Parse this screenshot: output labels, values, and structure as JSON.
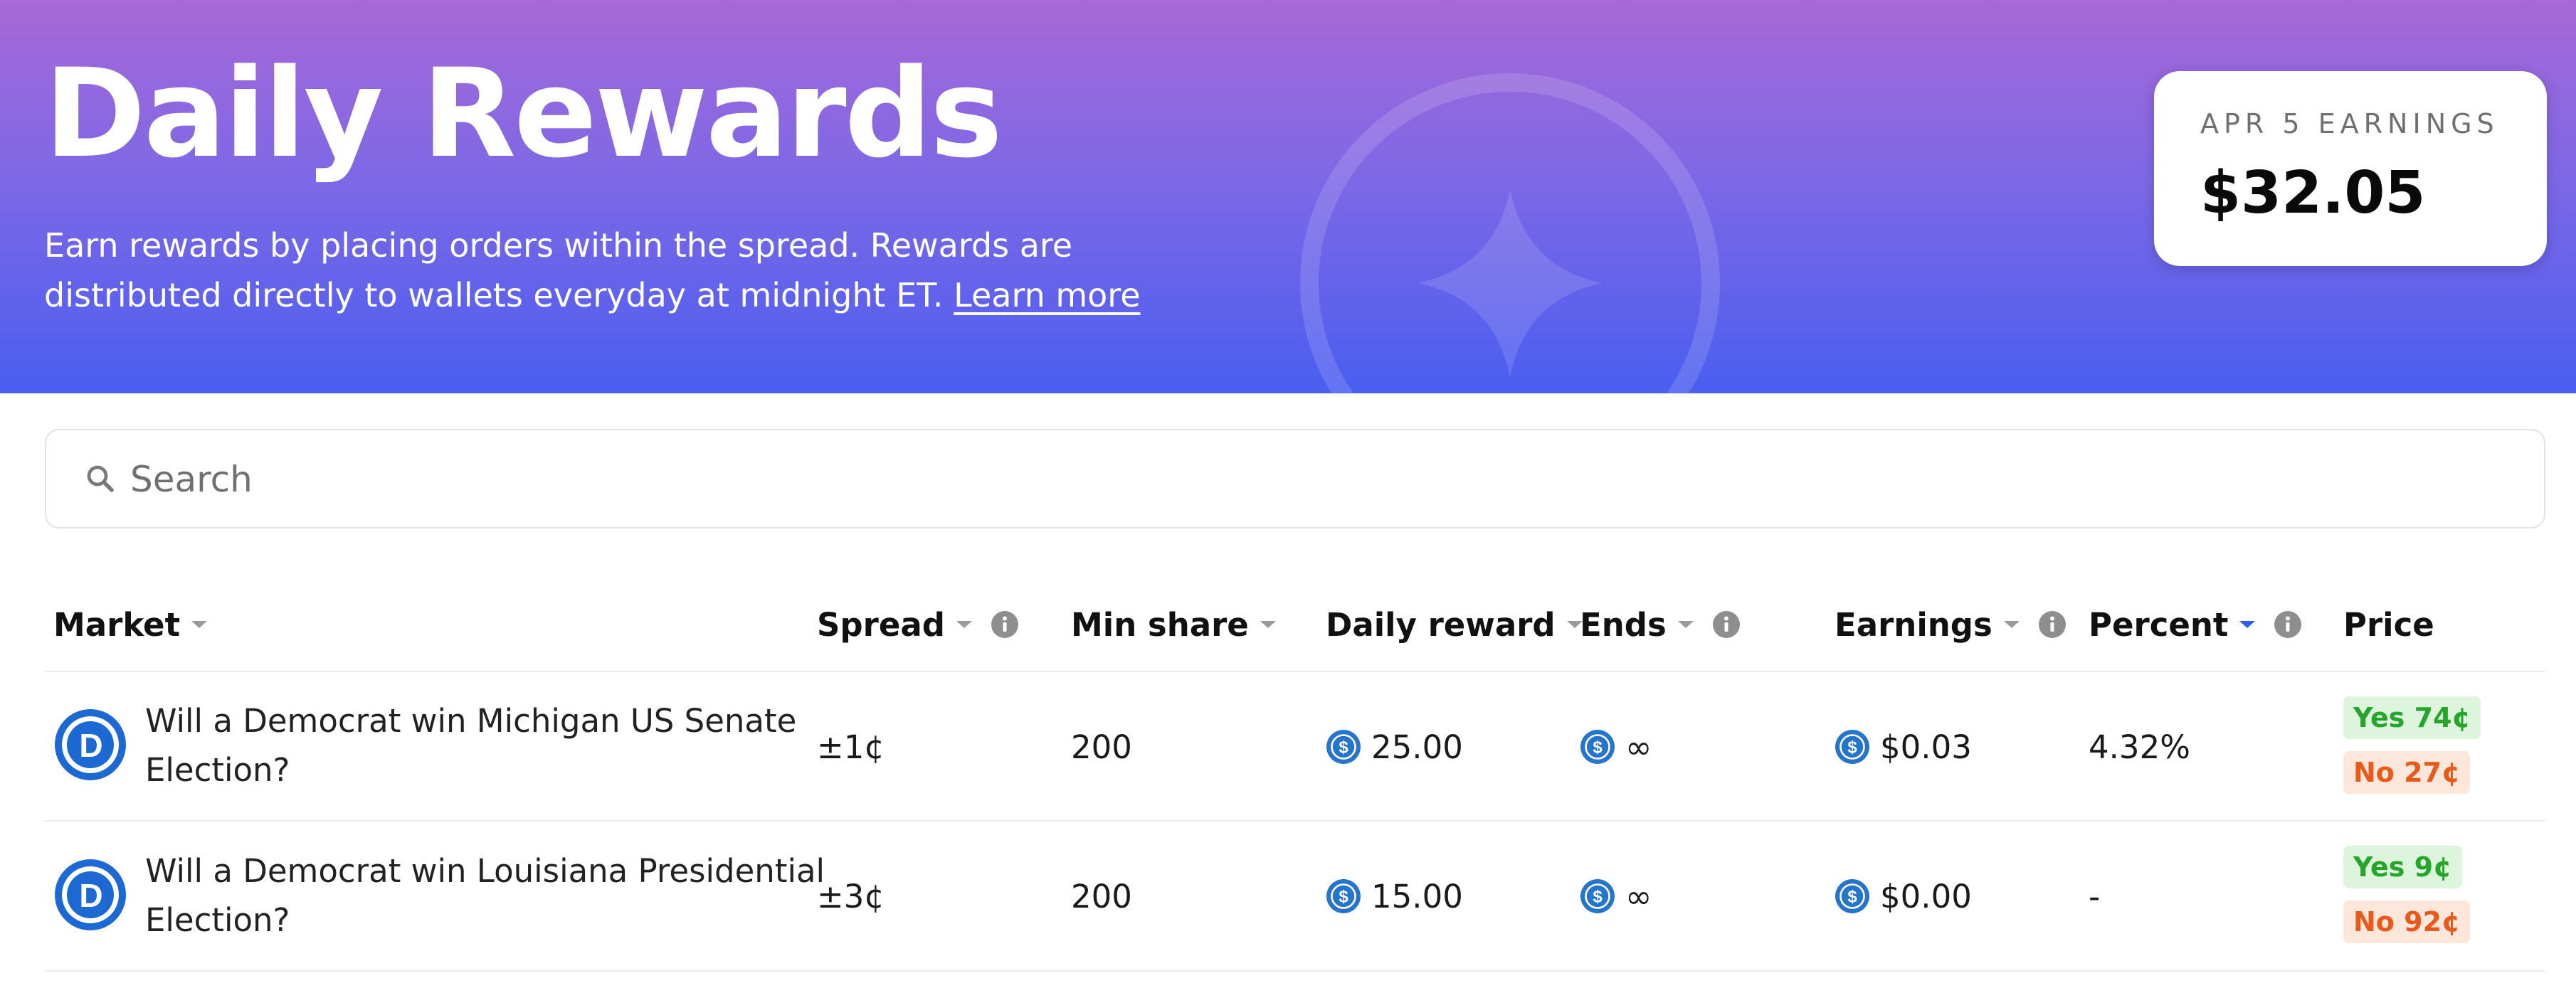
{
  "hero": {
    "title": "Daily Rewards",
    "description": "Earn rewards by placing orders within the spread. Rewards are distributed directly to wallets everyday at midnight ET.",
    "learn_more": "Learn more"
  },
  "earnings_card": {
    "label": "APR 5 EARNINGS",
    "value": "$32.05"
  },
  "search": {
    "placeholder": "Search"
  },
  "columns": {
    "market": "Market",
    "spread": "Spread",
    "min_share": "Min share",
    "daily_reward": "Daily reward",
    "ends": "Ends",
    "earnings": "Earnings",
    "percent": "Percent",
    "price": "Price"
  },
  "sort": {
    "active_column": "percent",
    "direction": "descending"
  },
  "rows": [
    {
      "market": "Will a Democrat win Michigan US Senate Election?",
      "spread": "±1¢",
      "min_share": "200",
      "daily_reward": "25.00",
      "ends": "∞",
      "earnings": "$0.03",
      "percent": "4.32%",
      "yes": "Yes 74¢",
      "no": "No 27¢"
    },
    {
      "market": "Will a Democrat win Louisiana Presidential Election?",
      "spread": "±3¢",
      "min_share": "200",
      "daily_reward": "15.00",
      "ends": "∞",
      "earnings": "$0.00",
      "percent": "-",
      "yes": "Yes 9¢",
      "no": "No 92¢"
    }
  ],
  "colors": {
    "hero_top": "#a868d6",
    "hero_bottom": "#4a5ef0",
    "yes_text": "#27a52b",
    "yes_bg": "#dcf5dc",
    "no_text": "#e8591c",
    "no_bg": "#fde6da",
    "coin": "#2775ca",
    "democrat_logo": "#1c69d3",
    "sort_active": "#2f5ef2"
  },
  "icons": {
    "search": "search-icon",
    "info": "info-icon",
    "sort": "sort-caret-icon",
    "coin": "usdc-coin-icon",
    "market_logo": "democrat-logo"
  }
}
